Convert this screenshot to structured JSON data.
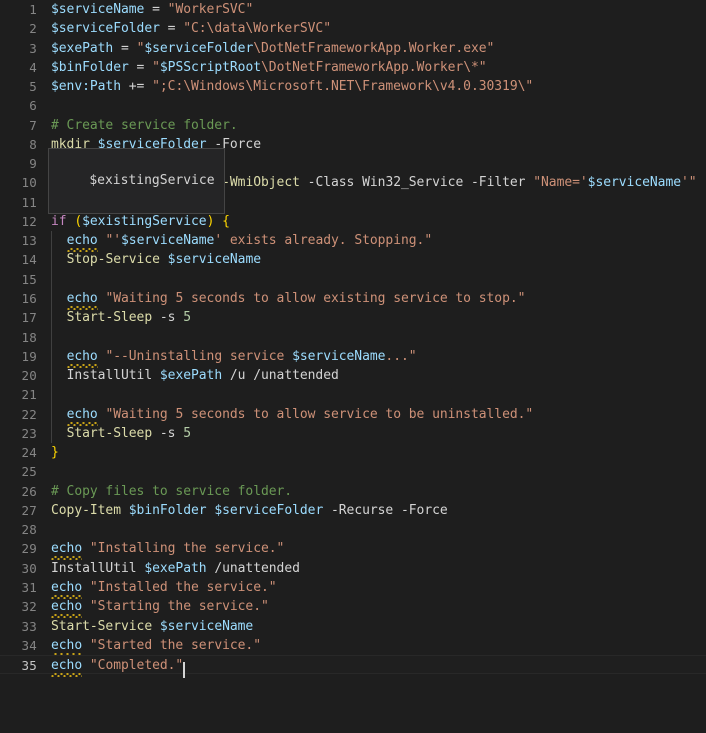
{
  "editor": {
    "language": "PowerShell",
    "theme": "Dark+",
    "total_lines": 35,
    "active_line": 35,
    "cursor_column_text": "echo \"Completed.\"",
    "colors": {
      "background": "#1e1e1e",
      "line_number": "#858585",
      "line_number_active": "#c6c6c6",
      "variable": "#9cdcfe",
      "string": "#ce9178",
      "cmdlet": "#dcdcaa",
      "keyword": "#c586c0",
      "comment": "#6a9955",
      "operator": "#d4d4d4",
      "number": "#b5cea8",
      "bracket": "#ffd700",
      "warning_squiggle": "#c8a317",
      "word_highlight": "#2d4a5e",
      "current_line": "#1f1f1f",
      "popup_bg": "#252526",
      "popup_border": "#454545"
    }
  },
  "hover_popup": {
    "text": "$existingService",
    "visible": true
  },
  "lines": [
    {
      "n": "1",
      "text": "$serviceName = \"WorkerSVC\""
    },
    {
      "n": "2",
      "text": "$serviceFolder = \"C:\\data\\WorkerSVC\""
    },
    {
      "n": "3",
      "text": "$exePath = \"$serviceFolder\\DotNetFrameworkApp.Worker.exe\""
    },
    {
      "n": "4",
      "text": "$binFolder = \"$PSScriptRoot\\DotNetFrameworkApp.Worker\\*\""
    },
    {
      "n": "5",
      "text": "$env:Path += \";C:\\Windows\\Microsoft.NET\\Framework\\v4.0.30319\\\""
    },
    {
      "n": "6",
      "text": ""
    },
    {
      "n": "7",
      "text": "# Create service folder."
    },
    {
      "n": "8",
      "text": "mkdir $serviceFolder -Force"
    },
    {
      "n": "9",
      "text": ""
    },
    {
      "n": "10",
      "text": "$existingService = Get-WmiObject -Class Win32_Service -Filter \"Name='$serviceName'\""
    },
    {
      "n": "11",
      "text": ""
    },
    {
      "n": "12",
      "text": "if ($existingService) {"
    },
    {
      "n": "13",
      "text": "  echo \"'$serviceName' exists already. Stopping.\""
    },
    {
      "n": "14",
      "text": "  Stop-Service $serviceName"
    },
    {
      "n": "15",
      "text": ""
    },
    {
      "n": "16",
      "text": "  echo \"Waiting 5 seconds to allow existing service to stop.\""
    },
    {
      "n": "17",
      "text": "  Start-Sleep -s 5"
    },
    {
      "n": "18",
      "text": ""
    },
    {
      "n": "19",
      "text": "  echo \"--Uninstalling service $serviceName...\""
    },
    {
      "n": "20",
      "text": "  InstallUtil $exePath /u /unattended"
    },
    {
      "n": "21",
      "text": ""
    },
    {
      "n": "22",
      "text": "  echo \"Waiting 5 seconds to allow service to be uninstalled.\""
    },
    {
      "n": "23",
      "text": "  Start-Sleep -s 5"
    },
    {
      "n": "24",
      "text": "}"
    },
    {
      "n": "25",
      "text": ""
    },
    {
      "n": "26",
      "text": "# Copy files to service folder."
    },
    {
      "n": "27",
      "text": "Copy-Item $binFolder $serviceFolder -Recurse -Force"
    },
    {
      "n": "28",
      "text": ""
    },
    {
      "n": "29",
      "text": "echo \"Installing the service.\""
    },
    {
      "n": "30",
      "text": "InstallUtil $exePath /unattended"
    },
    {
      "n": "31",
      "text": "echo \"Installed the service.\""
    },
    {
      "n": "32",
      "text": "echo \"Starting the service.\""
    },
    {
      "n": "33",
      "text": "Start-Service $serviceName"
    },
    {
      "n": "34",
      "text": "echo \"Started the service.\""
    },
    {
      "n": "35",
      "text": "echo \"Completed.\""
    }
  ]
}
